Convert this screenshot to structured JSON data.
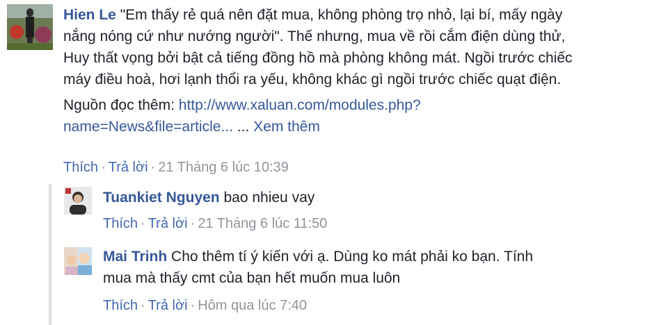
{
  "main_comment": {
    "author": "Hien Le",
    "text_lines": [
      "\"Em thấy rẻ quá nên đặt mua, không phòng trọ nhỏ, lại bí, mấy ngày",
      "nắng nóng cứ như nướng người\". Thế nhưng, mua về rồi cắm điện dùng thử,",
      "Huy thất vọng bởi bật cả tiếng đồng hồ mà phòng không mát. Ngồi trước chiếc",
      "máy điều hoà, hơi lạnh thổi ra yếu, không khác gì ngồi trước chiếc quạt điện."
    ],
    "source_label": "Nguồn đọc thêm: ",
    "source_link_line1": "http://www.xaluan.com/modules.php?",
    "source_link_line2": "name=News&file=article...",
    "ellipsis": " ... ",
    "see_more": "Xem thêm",
    "like": "Thích",
    "reply": "Trả lời",
    "separator": "·",
    "timestamp": "21 Tháng 6 lúc 10:39"
  },
  "replies": [
    {
      "author": "Tuankiet Nguyen",
      "text_lines": [
        "bao nhieu vay"
      ],
      "like": "Thích",
      "reply": "Trả lời",
      "separator": "·",
      "timestamp": "21 Tháng 6 lúc 11:50"
    },
    {
      "author": "Mai Trinh",
      "text_lines": [
        "Cho thêm tí ý kiến với ạ. Dùng ko mát phải ko bạn. Tính",
        "mua mà thấy cmt của bạn hết muốn mua luôn"
      ],
      "like": "Thích",
      "reply": "Trả lời",
      "separator": "·",
      "timestamp": "Hôm qua lúc 7:40"
    }
  ],
  "colors": {
    "name": "#365899",
    "action": "#4267b2",
    "meta": "#90949c",
    "thread_line": "#dddfe2"
  }
}
